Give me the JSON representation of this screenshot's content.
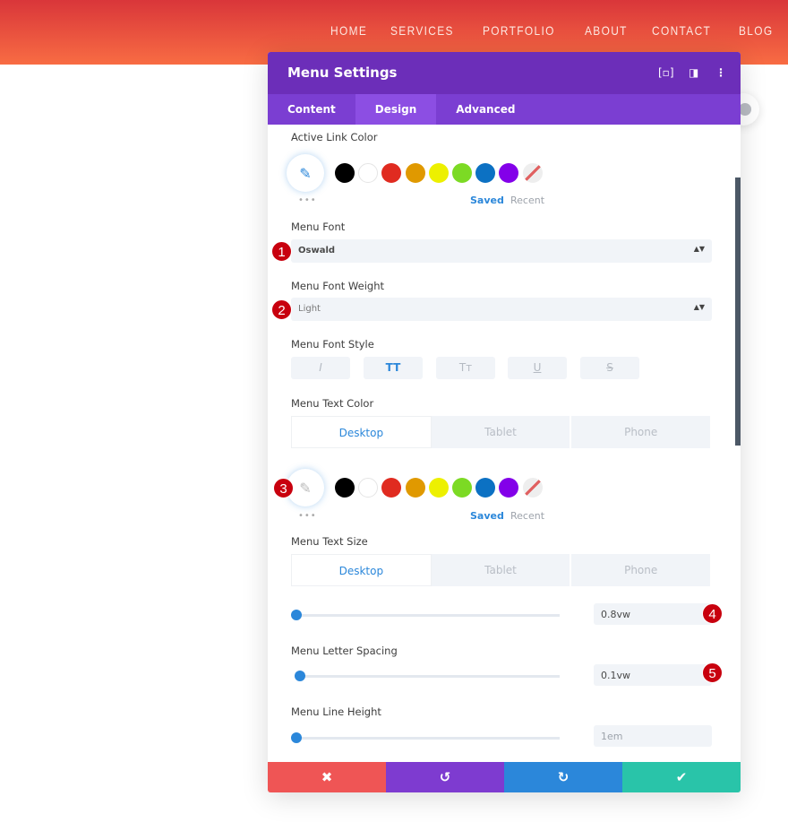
{
  "nav": [
    "HOME",
    "SERVICES",
    "PORTFOLIO",
    "ABOUT",
    "CONTACT",
    "BLOG"
  ],
  "modal": {
    "title": "Menu Settings",
    "tabs": [
      "Content",
      "Design",
      "Advanced"
    ],
    "active_tab": "Design"
  },
  "palette": [
    "#000000",
    "#ffffff",
    "#e02b20",
    "#e09900",
    "#edf000",
    "#7cda24",
    "#0c71c3",
    "#8300e9"
  ],
  "active_link": {
    "label": "Active Link Color",
    "saved": "Saved",
    "recent": "Recent",
    "more": "•••"
  },
  "menu_font": {
    "label": "Menu Font",
    "value": "Oswald"
  },
  "font_weight": {
    "label": "Menu Font Weight",
    "value": "Light"
  },
  "font_style": {
    "label": "Menu Font Style",
    "buttons": [
      "I",
      "TT",
      "Tт",
      "U",
      "S"
    ],
    "active": "TT"
  },
  "text_color": {
    "label": "Menu Text Color",
    "devices": [
      "Desktop",
      "Tablet",
      "Phone"
    ],
    "saved": "Saved",
    "recent": "Recent",
    "more": "•••"
  },
  "text_size": {
    "label": "Menu Text Size",
    "devices": [
      "Desktop",
      "Tablet",
      "Phone"
    ],
    "value": "0.8vw"
  },
  "letter_spacing": {
    "label": "Menu Letter Spacing",
    "value": "0.1vw"
  },
  "line_height": {
    "label": "Menu Line Height",
    "value": "1em"
  },
  "badges": [
    "1",
    "2",
    "3",
    "4",
    "5"
  ],
  "footer": {
    "cancel": "✖",
    "undo": "↺",
    "redo": "↻",
    "save": "✔",
    "colors": [
      "#ef5555",
      "#7e3bd0",
      "#2b87da",
      "#29c4a9"
    ]
  }
}
